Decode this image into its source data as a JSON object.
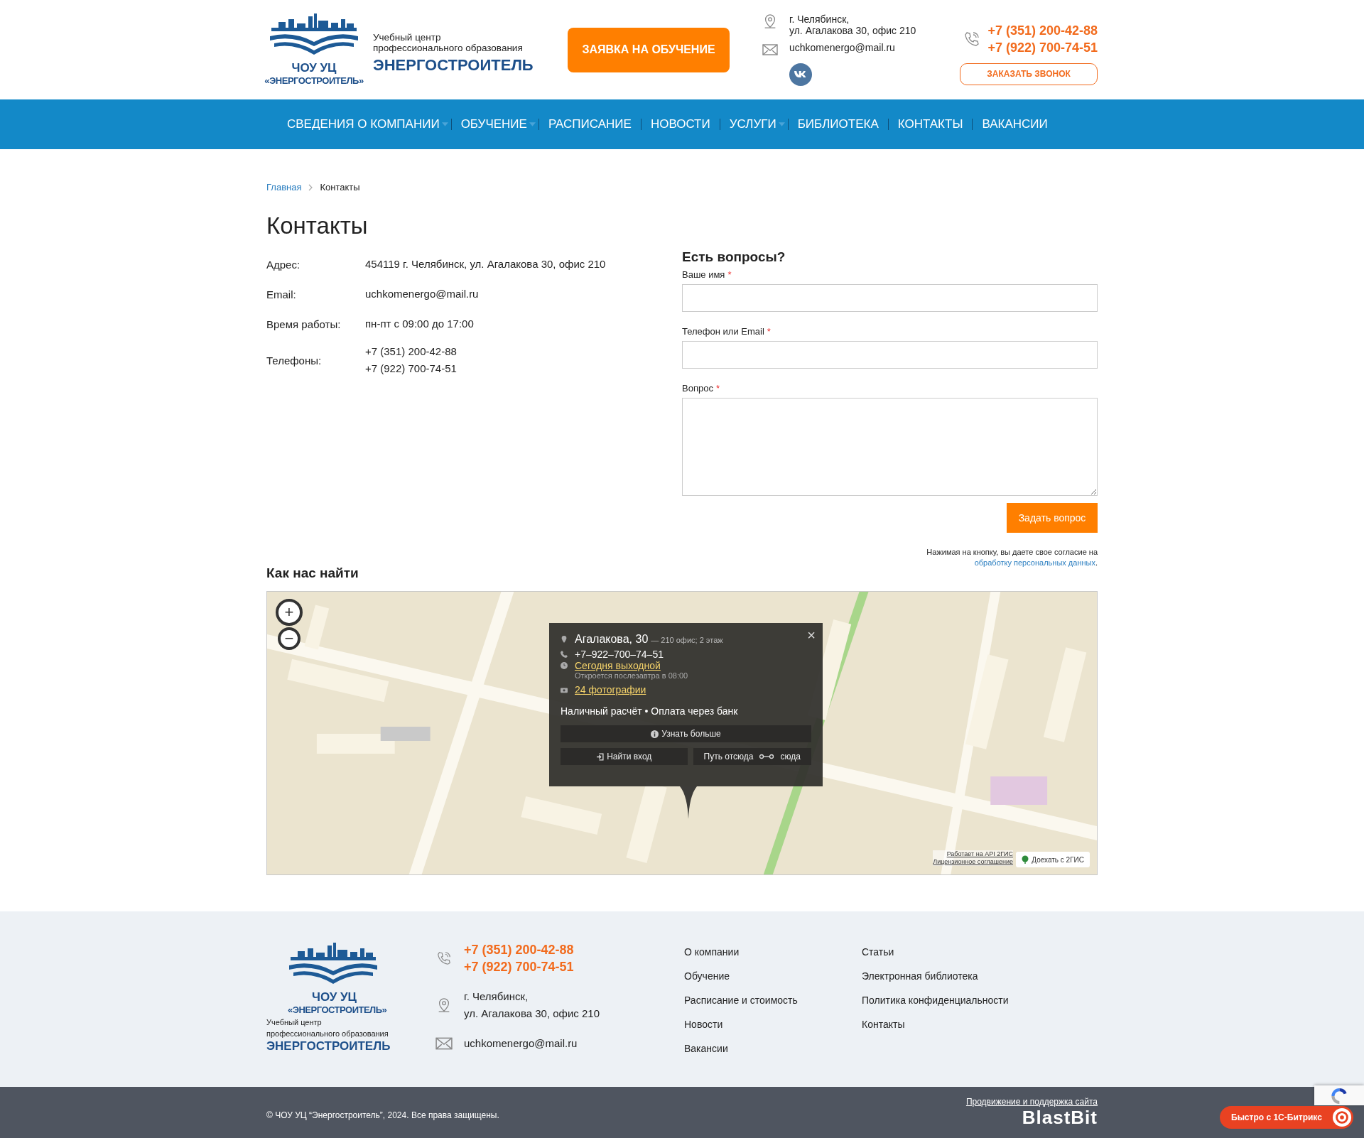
{
  "header": {
    "logo": {
      "line1": "ЧОУ УЦ",
      "line2": "«ЭНЕРГОСТРОИТЕЛЬ»"
    },
    "tagline": {
      "line1": "Учебный центр",
      "line2": "профессионального образования",
      "name": "ЭНЕРГОСТРОИТЕЛЬ"
    },
    "apply_button": "ЗАЯВКА НА ОБУЧЕНИЕ",
    "address": [
      "г. Челябинск,",
      "ул. Агалакова 30, офис 210"
    ],
    "email": "uchkomenergo@mail.ru",
    "phones": [
      "+7 (351) 200-42-88",
      "+7 (922) 700-74-51"
    ],
    "callback_button": "ЗАКАЗАТЬ ЗВОНОК"
  },
  "nav": [
    {
      "label": "СВЕДЕНИЯ О КОМПАНИИ",
      "dropdown": true
    },
    {
      "label": "ОБУЧЕНИЕ",
      "dropdown": true
    },
    {
      "label": "РАСПИСАНИЕ",
      "dropdown": false
    },
    {
      "label": "НОВОСТИ",
      "dropdown": false
    },
    {
      "label": "УСЛУГИ",
      "dropdown": true
    },
    {
      "label": "БИБЛИОТЕКА",
      "dropdown": false
    },
    {
      "label": "КОНТАКТЫ",
      "dropdown": false
    },
    {
      "label": "ВАКАНСИИ",
      "dropdown": false
    }
  ],
  "breadcrumbs": [
    {
      "label": "Главная",
      "kind": "link"
    },
    {
      "label": "Контакты",
      "kind": "current"
    }
  ],
  "title": "Контакты",
  "contacts": [
    {
      "label": "Адрес:",
      "values": [
        "454119 г. Челябинск, ул. Агалакова 30, офис 210"
      ]
    },
    {
      "label": "Email:",
      "values": [
        "uchkomenergo@mail.ru"
      ]
    },
    {
      "label": "Время работы:",
      "values": [
        "пн-пт с 09:00 до 17:00"
      ]
    },
    {
      "label": "Телефоны:",
      "values": [
        "+7 (351) 200-42-88",
        "+7 (922) 700-74-51"
      ]
    }
  ],
  "form": {
    "title": "Есть вопросы?",
    "fields": [
      {
        "label": "Ваше имя",
        "required_mark": "*",
        "kind": "input"
      },
      {
        "label": "Телефон или Email",
        "required_mark": "*",
        "kind": "input"
      },
      {
        "label": "Вопрос",
        "required_mark": "*",
        "kind": "textarea"
      }
    ],
    "submit": "Задать вопрос",
    "consent": "Нажимая на кнопку, вы даете свое согласие на",
    "consent_link": "обработку персональных данных",
    "consent_end": "."
  },
  "map": {
    "title": "Как нас найти",
    "zoom_in": "+",
    "zoom_out": "−",
    "popup": {
      "close": "×",
      "title": "Агалакова, 30",
      "subtitle": "— 210 офис; 2 этаж",
      "phone": "+7–922–700–74–51",
      "hours": "Сегодня выходной",
      "hours_note": "Откроется послезавтра в 08:00",
      "photos": "24 фотографии",
      "payment": "Наличный расчёт • Оплата через банк",
      "more_button": "Узнать больше",
      "entrance_button": "Найти вход",
      "route_from": "Путь отсюда",
      "route_to": "сюда"
    },
    "attribution": [
      "Работает на API 2ГИС",
      "Лицензионное соглашение"
    ],
    "route_button": "Доехать с 2ГИС"
  },
  "footer": {
    "logo": {
      "line1": "ЧОУ УЦ",
      "line2": "«ЭНЕРГОСТРОИТЕЛЬ»"
    },
    "tagline": {
      "line1": "Учебный центр",
      "line2": "профессионального образования",
      "name": "ЭНЕРГОСТРОИТЕЛЬ"
    },
    "phones": [
      "+7 (351) 200-42-88",
      "+7 (922) 700-74-51"
    ],
    "address": [
      "г. Челябинск,",
      "ул. Агалакова 30, офис 210"
    ],
    "email": "uchkomenergo@mail.ru",
    "links": [
      [
        "О компании",
        "Обучение",
        "Расписание и стоимость",
        "Новости",
        "Вакансии"
      ],
      [
        "Статьи",
        "Электронная библиотека",
        "Политика конфиденциальности",
        "Контакты"
      ]
    ],
    "copyright": "© ЧОУ УЦ “Энергостроитель”, 2024. Все права защищены.",
    "promo_link": "Продвижение и поддержка сайта",
    "developer_logo": "BlastBit"
  },
  "bitrix_badge": "Быстро с 1С-Битрикс"
}
